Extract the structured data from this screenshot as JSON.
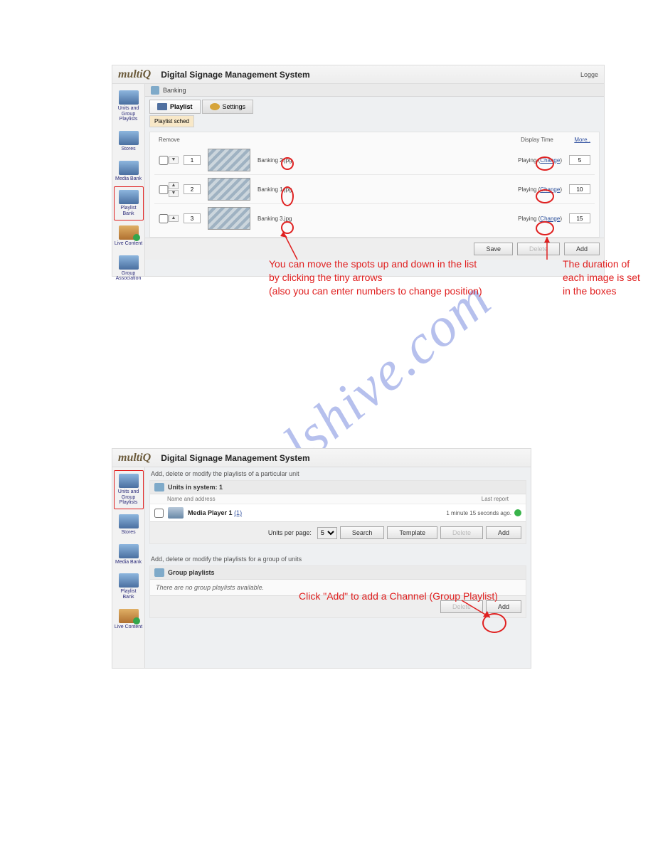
{
  "watermark": "manualshive.com",
  "shot1": {
    "logo": "multiQ",
    "header_title": "Digital Signage Management System",
    "logged": "Logge",
    "sidebar": [
      {
        "label": "Units and Group Playlists",
        "selected": false
      },
      {
        "label": "Stores",
        "selected": false
      },
      {
        "label": "Media Bank",
        "selected": false
      },
      {
        "label": "Playlist Bank",
        "selected": true
      },
      {
        "label": "Live Content",
        "selected": false,
        "green": true
      },
      {
        "label": "Group Association",
        "selected": false
      }
    ],
    "breadcrumb": "Banking",
    "tabs": {
      "playlist": "Playlist",
      "settings": "Settings",
      "sched": "Playlist sched"
    },
    "playlist": {
      "col_remove": "Remove",
      "col_display_time": "Display Time",
      "more": "More..",
      "rows": [
        {
          "order": "1",
          "file": "Banking 2.jpg",
          "status": "Playing",
          "change": "Change",
          "dur": "5",
          "up": false,
          "down": true
        },
        {
          "order": "2",
          "file": "Banking 1.jpg",
          "status": "Playing",
          "change": "Change",
          "dur": "10",
          "up": true,
          "down": true
        },
        {
          "order": "3",
          "file": "Banking 3.jpg",
          "status": "Playing",
          "change": "Change",
          "dur": "15",
          "up": true,
          "down": false
        }
      ],
      "buttons": {
        "save": "Save",
        "delete": "Delete",
        "add": "Add"
      }
    },
    "annotation_left": "You can move the spots up and down in the list\nby clicking the tiny arrows\n(also you can enter numbers to change position)",
    "annotation_right": "The duration of\neach image is set\nin the boxes"
  },
  "shot2": {
    "logo": "multiQ",
    "header_title": "Digital Signage Management System",
    "sidebar": [
      {
        "label": "Units and Group Playlists",
        "selected": true
      },
      {
        "label": "Stores",
        "selected": false
      },
      {
        "label": "Media Bank",
        "selected": false
      },
      {
        "label": "Playlist Bank",
        "selected": false
      },
      {
        "label": "Live Content",
        "selected": false,
        "green": true
      }
    ],
    "info_top": "Add, delete or modify the playlists of a particular unit",
    "units_panel": {
      "title": "Units in system: 1",
      "col_name": "Name and address",
      "col_last": "Last report",
      "unit_name": "Media Player 1",
      "unit_id": "(1)",
      "unit_time": "1 minute 15 seconds ago."
    },
    "toolbar": {
      "units_per_page": "Units per page:",
      "per_page_value": "5",
      "search": "Search",
      "template": "Template",
      "delete": "Delete",
      "add": "Add"
    },
    "info_bottom": "Add, delete or modify the playlists for a group of units",
    "group_panel": {
      "title": "Group playlists",
      "empty": "There are no group playlists available.",
      "delete": "Delete",
      "add": "Add"
    },
    "annotation": "Click \"Add\" to add a Channel (Group Playlist)"
  }
}
